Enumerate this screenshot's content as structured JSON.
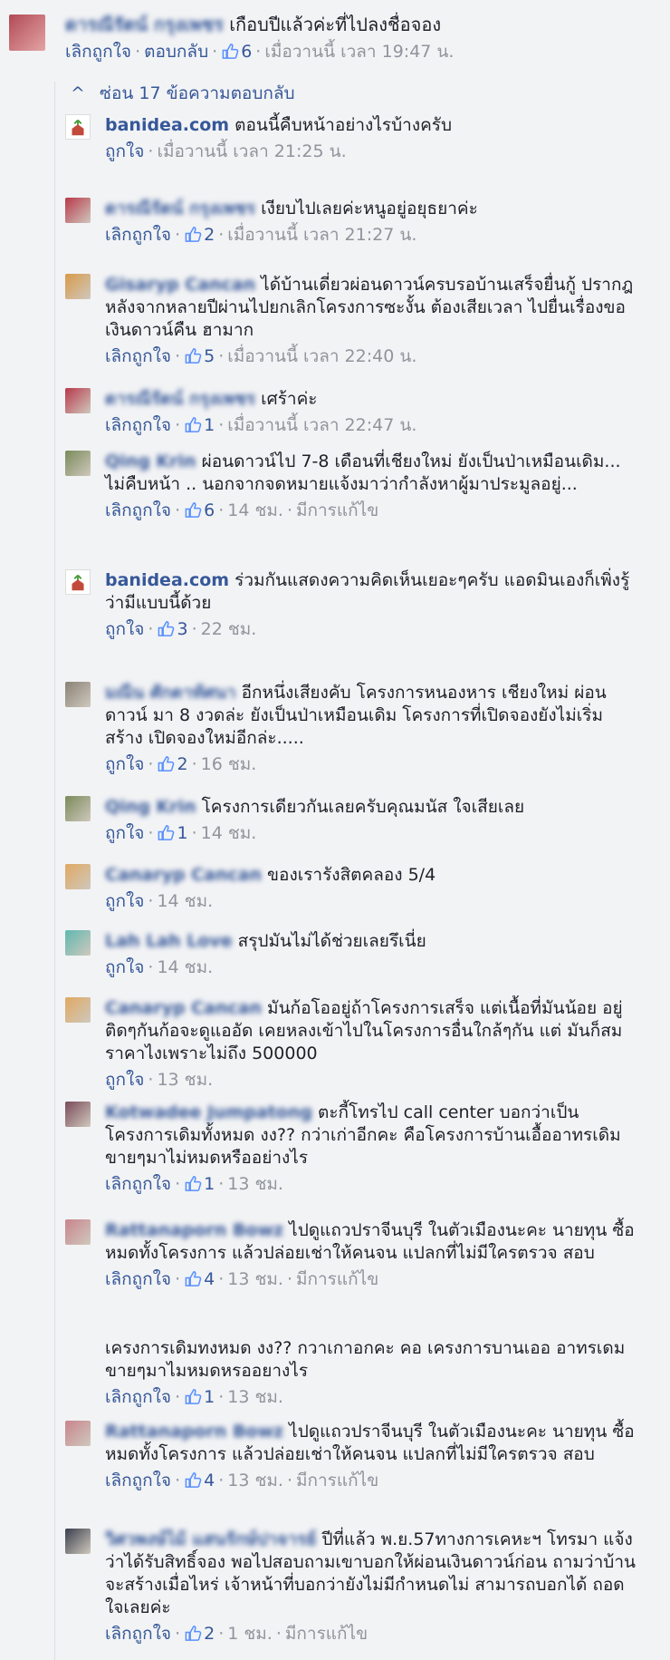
{
  "top_comment": {
    "author": "ดารณีรัตน์ กรุงเพชร",
    "text": "เกือบปีแล้วค่ะที่ไปลงชื่อจอง",
    "unlike": "เลิกถูกใจ",
    "reply": "ตอบกลับ",
    "likes": "6",
    "time": "เมื่อวานนี้ เวลา 19:47 น."
  },
  "hide_replies": "ซ่อน 17 ข้อความตอบกลับ",
  "replies": [
    {
      "author": "banidea.com",
      "text": "ตอนนี้คืบหน้าอย่างไรบ้างครับ",
      "like": "ถูกใจ",
      "likes": "",
      "time": "เมื่อวานนี้",
      "time2": "เวลา 21:25 น.",
      "edited": "",
      "avatar": "#e7efe4",
      "is_page": true
    },
    {
      "author": "ดารณีรัตน์ กรุงเพชร",
      "text": "เงียบไปเลยค่ะหนูอยู่อยุธยาค่ะ",
      "like": "เลิกถูกใจ",
      "likes": "2",
      "time": "เมื่อวานนี้ เวลา 21:27 น.",
      "edited": "",
      "avatar": "#b8384a"
    },
    {
      "author": "Gisaryp Cancan",
      "text": "ได้บ้านเดี่ยวผ่อนดาวน์ครบรอบ้านเสร็จยื่นกู้ ปรากฎหลังจากหลายปีผ่านไปยกเลิกโครงการซะงั้น ต้องเสียเวลา ไปยื่นเรื่องขอเงินดาวน์คืน ฮามาก",
      "like": "เลิกถูกใจ",
      "likes": "5",
      "time": "เมื่อวานนี้ เวลา 22:40 น.",
      "edited": "",
      "avatar": "#d99a4a"
    },
    {
      "author": "ดารณีรัตน์ กรุงเพชร",
      "text": "เศร้าค่ะ",
      "like": "เลิกถูกใจ",
      "likes": "1",
      "time": "เมื่อวานนี้ เวลา 22:47 น.",
      "edited": "",
      "avatar": "#b8384a"
    },
    {
      "author": "Qing Krin",
      "text": "ผ่อนดาวน์ไป 7-8 เดือนที่เชียงใหม่ ยังเป็นป่าเหมือนเดิม... ไม่คืบหน้า .. นอกจากจดหมายแจ้งมาว่ากำลังหาผู้มาประมูลอยู่...",
      "like": "เลิกถูกใจ",
      "likes": "6",
      "time": "14 ชม.",
      "edited": "มีการแก้ไข",
      "avatar": "#7a8a5a"
    },
    {
      "author": "banidea.com",
      "text": "ร่วมกันแสดงความคิดเห็นเยอะๆครับ แอดมินเองก็เพิ่งรู้ ว่ามีแบบนี้ด้วย",
      "like": "ถูกใจ",
      "likes": "3",
      "time": "22",
      "time2": "ชม.",
      "edited": "",
      "avatar": "#e7efe4",
      "is_page": true
    },
    {
      "author": "มณีน ศักดาทัศนา",
      "text": "อีกหนึ่งเสียงคับ โครงการหนองหาร เชียงใหม่ ผ่อนดาวน์ มา 8 งวดล่ะ ยังเป็นป่าเหมือนเดิม โครงการที่เปิดจองยังไม่เริ่มสร้าง เปิดจองใหม่อีกล่ะ.....",
      "like": "ถูกใจ",
      "likes": "2",
      "time": "16 ชม.",
      "edited": "",
      "avatar": "#8a8276"
    },
    {
      "author": "Qing Krin",
      "text": "โครงการเดียวกันเลยครับคุณมนัส ใจเสียเลย",
      "like": "ถูกใจ",
      "likes": "1",
      "time": "14 ชม.",
      "edited": "",
      "avatar": "#7a8a5a"
    },
    {
      "author": "Canaryp Cancan",
      "text": "ของเรารังสิตคลอง 5/4",
      "like": "ถูกใจ",
      "likes": "",
      "time": "14 ชม.",
      "edited": "",
      "avatar": "#e0a862"
    },
    {
      "author": "Lah Lah Love",
      "text": "สรุปมันไม่ได้ช่วยเลยรึเนี่ย",
      "like": "ถูกใจ",
      "likes": "",
      "time": "14 ชม.",
      "edited": "",
      "avatar": "#5fb8b0"
    },
    {
      "author": "Canaryp Cancan",
      "text": "มันก้อโออยู่ถ้าโครงการเสร็จ แต่เนื้อที่มันน้อย อยู่ติดๆกันก้อจะดูแออัด เคยหลงเข้าไปในโครงการอื่นใกล้ๆกัน แต่ มันก็สมราคาไงเพราะไม่ถึง 500000",
      "like": "ถูกใจ",
      "likes": "",
      "time": "13 ชม.",
      "edited": "",
      "avatar": "#e0a862"
    },
    {
      "author": "Kotwadee Jumpatong",
      "text": "ตะกี้โทรไป call center บอกว่าเป็น โครงการเดิมทั้งหมด งง?? กว่าเก่าอีกคะ คือโครงการบ้านเอื้ออาทรเดิม ขายๆมาไม่หมดหรืออย่างไร",
      "like": "เลิกถูกใจ",
      "likes": "1",
      "time": "13 ชม.",
      "edited": "",
      "avatar": "#7a4a5a"
    },
    {
      "author": "Rattanaporn Bowz",
      "text": "ไปดูแถวปราจีนบุรี ในตัวเมืองนะคะ นายทุน ซื้อหมดทั้งโครงการ แล้วปล่อยเช่าให้คนจน แปลกที่ไม่มีใครตรวจ สอบ",
      "like": "เลิกถูกใจ",
      "likes": "4",
      "time": "13 ชม.",
      "edited": "มีการแก้ไข",
      "avatar": "#c9848c"
    },
    {
      "author": "",
      "text": "เครงการเดิมทงหมด งง?? กวาเกาอกคะ คอ เครงการบานเออ อาทรเดม ขายๆมาไมหมดหรออยางไร",
      "like": "เลิกถูกใจ",
      "likes": "1",
      "time": "13 ชม.",
      "edited": "",
      "avatar": ""
    },
    {
      "author": "Rattanaporn Bowz",
      "text": "ไปดูแถวปราจีนบุรี ในตัวเมืองนะคะ นายทุน ซื้อหมดทั้งโครงการ แล้วปล่อยเช่าให้คนจน แปลกที่ไม่มีใครตรวจ สอบ",
      "like": "เลิกถูกใจ",
      "likes": "4",
      "time": "13 ชม.",
      "edited": "มีการแก้ไข",
      "avatar": "#c9848c"
    },
    {
      "author": "วิศวพงษ์ไม้ แสนรักษ์ปาจารย์",
      "text": "ปีที่แล้ว พ.ย.57ทางการเคหะฯ โทรมา แจ้งว่าได้รับสิทธิ์จอง พอไปสอบถามเขาบอกให้ผ่อนเงินดาวน์ก่อน ถามว่าบ้านจะสร้างเมื่อไหร่ เจ้าหน้าที่บอกว่ายังไม่มีกำหนดไม่ สามารถบอกได้ ถอดใจเลยค่ะ",
      "like": "เลิกถูกใจ",
      "likes": "2",
      "time": "1 ชม.",
      "edited": "มีการแก้ไข",
      "avatar": "#3a3f4d"
    }
  ]
}
